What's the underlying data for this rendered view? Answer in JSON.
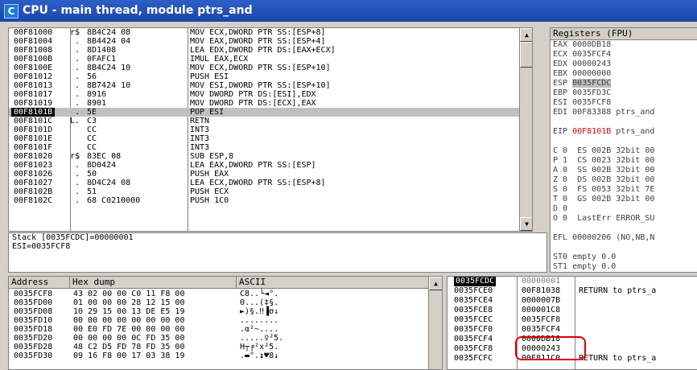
{
  "window": {
    "title": "CPU - main thread, module ptrs_and",
    "icon_letter": "C"
  },
  "disasm": {
    "rows": [
      {
        "addr": "00F81000",
        "mark": "r$",
        "hex": "8B4C24 08",
        "asm": "MOV ECX,DWORD PTR SS:[ESP+8]"
      },
      {
        "addr": "00F81004",
        "mark": " .",
        "hex": "8B4424 04",
        "asm": "MOV EAX,DWORD PTR SS:[ESP+4]"
      },
      {
        "addr": "00F81008",
        "mark": " .",
        "hex": "8D1408",
        "asm": "LEA EDX,DWORD PTR DS:[EAX+ECX]"
      },
      {
        "addr": "00F8100B",
        "mark": " .",
        "hex": "0FAFC1",
        "asm": "IMUL EAX,ECX"
      },
      {
        "addr": "00F8100E",
        "mark": " .",
        "hex": "8B4C24 10",
        "asm": "MOV ECX,DWORD PTR SS:[ESP+10]"
      },
      {
        "addr": "00F81012",
        "mark": " .",
        "hex": "56",
        "asm": "PUSH ESI"
      },
      {
        "addr": "00F81013",
        "mark": " .",
        "hex": "8B7424 10",
        "asm": "MOV ESI,DWORD PTR SS:[ESP+10]"
      },
      {
        "addr": "00F81017",
        "mark": " .",
        "hex": "8916",
        "asm": "MOV DWORD PTR DS:[ESI],EDX"
      },
      {
        "addr": "00F81019",
        "mark": " .",
        "hex": "8901",
        "asm": "MOV DWORD PTR DS:[ECX],EAX"
      },
      {
        "addr": "00F8101B",
        "mark": " .",
        "hex": "5E",
        "asm": "POP ESI",
        "selected": true
      },
      {
        "addr": "00F8101C",
        "mark": "L.",
        "hex": "C3",
        "asm": "RETN"
      },
      {
        "addr": "00F8101D",
        "mark": "",
        "hex": "CC",
        "asm": "INT3"
      },
      {
        "addr": "00F8101E",
        "mark": "",
        "hex": "CC",
        "asm": "INT3"
      },
      {
        "addr": "00F8101F",
        "mark": "",
        "hex": "CC",
        "asm": "INT3"
      },
      {
        "addr": "00F81020",
        "mark": "r$",
        "hex": "83EC 08",
        "asm": "SUB ESP,8"
      },
      {
        "addr": "00F81023",
        "mark": " .",
        "hex": "8D0424",
        "asm": "LEA EAX,DWORD PTR SS:[ESP]"
      },
      {
        "addr": "00F81026",
        "mark": " .",
        "hex": "50",
        "asm": "PUSH EAX"
      },
      {
        "addr": "00F81027",
        "mark": " .",
        "hex": "8D4C24 08",
        "asm": "LEA ECX,DWORD PTR SS:[ESP+8]"
      },
      {
        "addr": "00F8102B",
        "mark": " .",
        "hex": "51",
        "asm": "PUSH ECX"
      },
      {
        "addr": "00F8102C",
        "mark": " .",
        "hex": "68 C0210000",
        "asm": "PUSH 1C0"
      }
    ]
  },
  "info": {
    "line1": "Stack [0035FCDC]=00000001",
    "line2": "ESI=0035FCF8"
  },
  "registers": {
    "header": "Registers (FPU)",
    "rows": [
      {
        "text": "EAX 0000DB18"
      },
      {
        "text": "ECX 0035FCF4"
      },
      {
        "text": "EDX 00000243"
      },
      {
        "text": "EBX 00000000"
      },
      {
        "text": "ESP 0035FCDC",
        "hl": true
      },
      {
        "text": "EBP 0035FD3C"
      },
      {
        "text": "ESI 0035FCF8"
      },
      {
        "text": "EDI 00F83388 ptrs_and"
      },
      {
        "text": ""
      },
      {
        "text": "EIP 00F8101B ptrs_and",
        "red": "00F8101B"
      },
      {
        "text": ""
      },
      {
        "text": "C 0  ES 002B 32bit 00"
      },
      {
        "text": "P 1  CS 0023 32bit 00"
      },
      {
        "text": "A 0  SS 002B 32bit 00"
      },
      {
        "text": "Z 0  DS 002B 32bit 00"
      },
      {
        "text": "S 0  FS 0053 32bit 7E"
      },
      {
        "text": "T 0  GS 002B 32bit 00"
      },
      {
        "text": "D 0"
      },
      {
        "text": "O 0  LastErr ERROR_SU"
      },
      {
        "text": ""
      },
      {
        "text": "EFL 00000206 (NO,NB,N"
      },
      {
        "text": ""
      },
      {
        "text": "ST0 empty 0.0"
      },
      {
        "text": "ST1 empty 0.0"
      }
    ]
  },
  "dump": {
    "headers": {
      "address": "Address",
      "hex": "Hex dump",
      "ascii": "ASCII"
    },
    "rows": [
      {
        "addr": "0035FCF8",
        "hex": "43 02 00 00 C0 11 F8 00",
        "ascii": "C8..└◄°."
      },
      {
        "addr": "0035FD00",
        "hex": "01 00 00 00 28 12 15 00",
        "ascii": "Θ...(‡§."
      },
      {
        "addr": "0035FD08",
        "hex": "10 29 15 00 13 DE E5 19",
        "ascii": "►)§.‼▐σ↓"
      },
      {
        "addr": "0035FD10",
        "hex": "00 00 00 00 00 00 00 00",
        "ascii": "........"
      },
      {
        "addr": "0035FD18",
        "hex": "00 E0 FD 7E 00 00 00 00",
        "ascii": ".α²~...."
      },
      {
        "addr": "0035FD20",
        "hex": "00 00 00 00 0C FD 35 00",
        "ascii": ".....♀²5."
      },
      {
        "addr": "0035FD28",
        "hex": "48 C2 D5 FD 78 FD 35 00",
        "ascii": "H┬╒²x²5."
      },
      {
        "addr": "0035FD30",
        "hex": "09 16 F8 00 17 03 38 19",
        "ascii": ".▬°.↨♥8↓"
      }
    ]
  },
  "stack": {
    "rows": [
      {
        "addr": "0035FCDC",
        "val": "00000001",
        "cmt": "",
        "sel": true
      },
      {
        "addr": "0035FCE0",
        "val": "00F81038",
        "cmt": "RETURN to ptrs_a"
      },
      {
        "addr": "0035FCE4",
        "val": "0000007B",
        "cmt": ""
      },
      {
        "addr": "0035FCE8",
        "val": "000001C8",
        "cmt": ""
      },
      {
        "addr": "0035FCEC",
        "val": "0035FCF8",
        "cmt": ""
      },
      {
        "addr": "0035FCF0",
        "val": "0035FCF4",
        "cmt": ""
      },
      {
        "addr": "0035FCF4",
        "val": "0000DB18",
        "cmt": ""
      },
      {
        "addr": "0035FCF8",
        "val": "00000243",
        "cmt": ""
      },
      {
        "addr": "0035FCFC",
        "val": "00F811C0",
        "cmt": "RETURN to ptrs_a"
      }
    ]
  }
}
